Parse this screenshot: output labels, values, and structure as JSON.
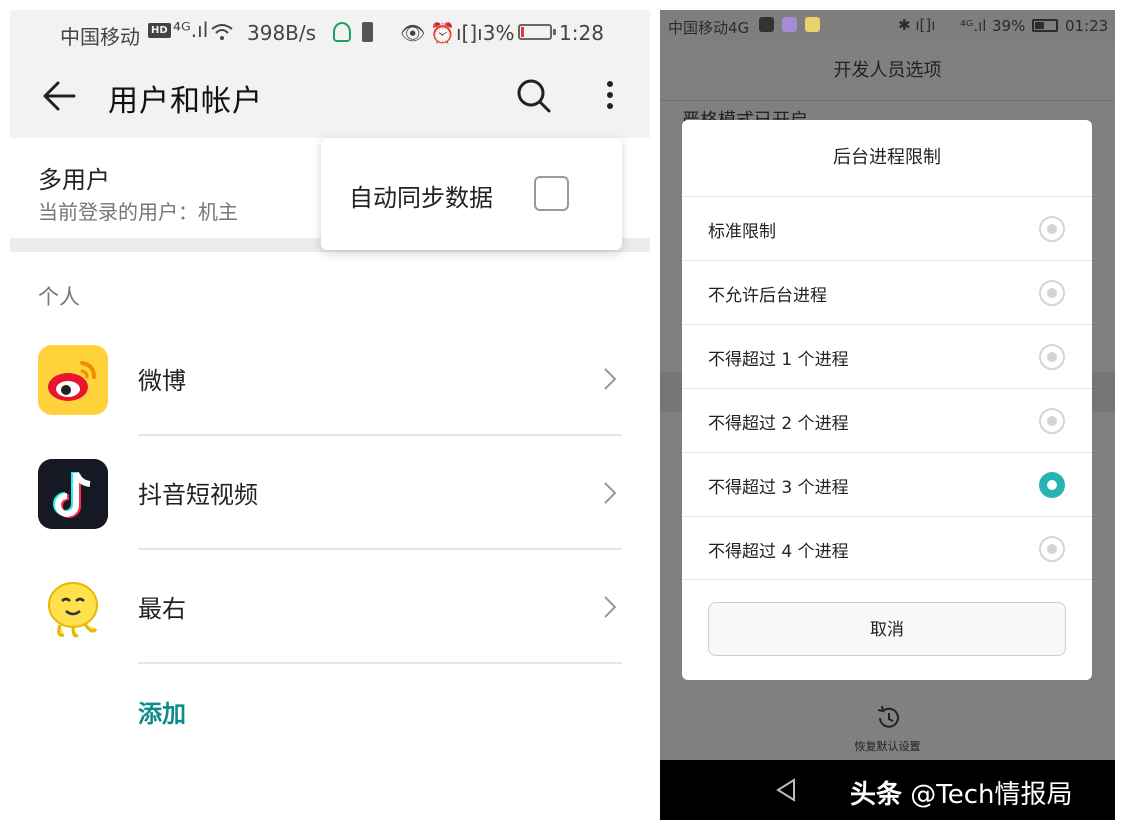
{
  "left_phone": {
    "status_bar": {
      "carrier": "中国移动",
      "hd_badge": "HD",
      "signal_label": "⁴ᴳ.ıl",
      "speed": "398B/s",
      "vibrate_battery": "ı[]ı3%",
      "time": "1:28"
    },
    "toolbar": {
      "title": "用户和帐户",
      "back_icon": "back-arrow-icon",
      "search_icon": "search-icon",
      "more_icon": "more-vert-icon"
    },
    "multi_user": {
      "title": "多用户",
      "subtitle": "当前登录的用户：机主"
    },
    "popup_menu": {
      "item_label": "自动同步数据",
      "checked": false
    },
    "section_header": "个人",
    "accounts": [
      {
        "label": "微博",
        "icon": "weibo-icon"
      },
      {
        "label": "抖音短视频",
        "icon": "douyin-icon"
      },
      {
        "label": "最右",
        "icon": "zuiyou-icon"
      }
    ],
    "add_label": "添加",
    "accent_color": "#0f8a8a"
  },
  "right_phone": {
    "status_bar": {
      "carrier": "中国移动4G",
      "bt_vib": "✱ ı[]ı",
      "signal": "⁴ᴳ.ıl",
      "battery_pct": "39%",
      "time": "01:23"
    },
    "header_title": "开发人员选项",
    "background_item": "严格模式已开启",
    "dialog": {
      "title": "后台进程限制",
      "options": [
        {
          "label": "标准限制",
          "selected": false
        },
        {
          "label": "不允许后台进程",
          "selected": false
        },
        {
          "label": "不得超过 1 个进程",
          "selected": false
        },
        {
          "label": "不得超过 2 个进程",
          "selected": false
        },
        {
          "label": "不得超过 3 个进程",
          "selected": true
        },
        {
          "label": "不得超过 4 个进程",
          "selected": false
        }
      ],
      "cancel_label": "取消",
      "selected_color": "#27b3b3"
    },
    "restore_defaults": "恢复默认设置",
    "watermark": {
      "brand": "头条",
      "handle": "@Tech情报局"
    }
  }
}
